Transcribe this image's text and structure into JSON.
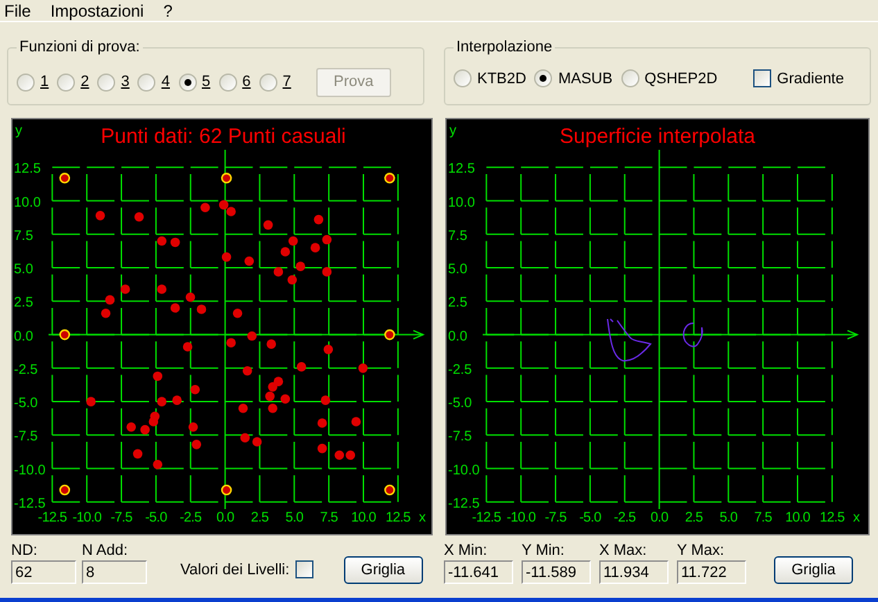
{
  "menu": [
    {
      "label": "File"
    },
    {
      "label": "Impostazioni"
    },
    {
      "label": "?"
    }
  ],
  "test_functions": {
    "title": "Funzioni di prova:",
    "options": [
      {
        "label": "1",
        "selected": false
      },
      {
        "label": "2",
        "selected": false
      },
      {
        "label": "3",
        "selected": false
      },
      {
        "label": "4",
        "selected": false
      },
      {
        "label": "5",
        "selected": true
      },
      {
        "label": "6",
        "selected": false
      },
      {
        "label": "7",
        "selected": false
      }
    ],
    "run_button": {
      "label": "Prova",
      "disabled": true
    }
  },
  "interpolation": {
    "title": "Interpolazione",
    "methods": [
      {
        "label": "KTB2D",
        "selected": false
      },
      {
        "label": "MASUB",
        "selected": true
      },
      {
        "label": "QSHEP2D",
        "selected": false
      }
    ],
    "gradient": {
      "label": "Gradiente",
      "checked": false
    }
  },
  "left_plot": {
    "chart_data": {
      "type": "scatter",
      "grid": true,
      "title": "Punti dati: 62 Punti casuali",
      "xlabel": "x",
      "ylabel": "y",
      "xlim": [
        -12.5,
        12.5
      ],
      "ylim": [
        -12.5,
        12.5
      ],
      "xticks": [
        {
          "value": -12.5,
          "label": "-12.5"
        },
        {
          "value": -10,
          "label": "-10.0"
        },
        {
          "value": -7.5,
          "label": "-7.5"
        },
        {
          "value": -5,
          "label": "-5.0"
        },
        {
          "value": -2.5,
          "label": "-2.5"
        },
        {
          "value": 0,
          "label": "0.0"
        },
        {
          "value": 2.5,
          "label": "2.5"
        },
        {
          "value": 5,
          "label": "5.0"
        },
        {
          "value": 7.5,
          "label": "7.5"
        },
        {
          "value": 10,
          "label": "10.0"
        },
        {
          "value": 12.5,
          "label": "12.5"
        }
      ],
      "yticks": [
        {
          "value": 12.5,
          "label": "12.5"
        },
        {
          "value": 10,
          "label": "10.0"
        },
        {
          "value": 7.5,
          "label": "7.5"
        },
        {
          "value": 5,
          "label": "5.0"
        },
        {
          "value": 2.5,
          "label": "2.5"
        },
        {
          "value": 0,
          "label": "0.0"
        },
        {
          "value": -2.5,
          "label": "-2.5"
        },
        {
          "value": -5,
          "label": "-5.0"
        },
        {
          "value": -7.5,
          "label": "-7.5"
        },
        {
          "value": -10,
          "label": "-10.0"
        },
        {
          "value": -12.5,
          "label": "-12.5"
        }
      ],
      "series": [
        {
          "color": "#e00000",
          "x": [
            -9.03,
            -6.22,
            -1.44,
            -0.1,
            0.43,
            3.11,
            6.76,
            -4.58,
            -3.61,
            4.92,
            7.36,
            6.52,
            4.35,
            0.1,
            1.74,
            5.45,
            3.85,
            4.85,
            7.36,
            -7.22,
            -4.58,
            -2.51,
            -8.33,
            -8.63,
            -3.61,
            -1.71,
            0.9,
            1.94,
            0.43,
            -2.71,
            3.34,
            7.46,
            5.52,
            1.61,
            9.97,
            -4.88,
            3.85,
            3.44,
            -2.17,
            3.24,
            4.35,
            -9.7,
            -4.58,
            -3.48,
            7.26,
            1.3,
            3.44,
            -5.08,
            -5.18,
            -6.79,
            -5.79,
            -2.31,
            7.02,
            9.47,
            1.44,
            2.31,
            -2.07,
            7.02,
            -6.32,
            8.26,
            9.06,
            -4.88
          ],
          "values": [
            8.9,
            8.8,
            9.5,
            9.7,
            9.2,
            8.2,
            8.6,
            7.0,
            6.9,
            7.0,
            7.1,
            6.5,
            6.2,
            5.8,
            5.5,
            5.1,
            4.7,
            4.1,
            4.7,
            3.4,
            3.4,
            2.8,
            2.6,
            1.6,
            2.0,
            1.9,
            1.6,
            -0.1,
            -0.6,
            -0.9,
            -0.7,
            -1.1,
            -2.4,
            -2.7,
            -2.5,
            -3.1,
            -3.5,
            -3.9,
            -4.1,
            -4.6,
            -4.8,
            -5.0,
            -5.0,
            -4.9,
            -4.9,
            -5.5,
            -5.5,
            -6.1,
            -6.5,
            -6.9,
            -7.1,
            -6.9,
            -6.6,
            -6.5,
            -7.7,
            -8.0,
            -8.2,
            -8.5,
            -8.9,
            -9.0,
            -9.0,
            -9.7
          ]
        },
        {
          "color": "#ffd700",
          "x": [
            -11.6,
            0.1,
            11.9,
            -11.6,
            11.9,
            -11.6,
            0.1,
            11.9
          ],
          "values": [
            11.7,
            11.7,
            11.7,
            0,
            0,
            -11.6,
            -11.6,
            -11.6
          ]
        }
      ]
    }
  },
  "right_plot": {
    "chart_data": {
      "type": "line",
      "grid": true,
      "title": "Superficie interpolata",
      "xlabel": "x",
      "ylabel": "y",
      "xlim": [
        -12.5,
        12.5
      ],
      "ylim": [
        -12.5,
        12.5
      ],
      "xticks": [
        {
          "value": -12.5,
          "label": "-12.5"
        },
        {
          "value": -10,
          "label": "-10.0"
        },
        {
          "value": -7.5,
          "label": "-7.5"
        },
        {
          "value": -5,
          "label": "-5.0"
        },
        {
          "value": -2.5,
          "label": "-2.5"
        },
        {
          "value": 0,
          "label": "0.0"
        },
        {
          "value": 2.5,
          "label": "2.5"
        },
        {
          "value": 5,
          "label": "5.0"
        },
        {
          "value": 7.5,
          "label": "7.5"
        },
        {
          "value": 10,
          "label": "10.0"
        },
        {
          "value": 12.5,
          "label": "12.5"
        }
      ],
      "yticks": [
        {
          "value": 12.5,
          "label": "12.5"
        },
        {
          "value": 10,
          "label": "10.0"
        },
        {
          "value": 7.5,
          "label": "7.5"
        },
        {
          "value": 5,
          "label": "5.0"
        },
        {
          "value": 2.5,
          "label": "2.5"
        },
        {
          "value": 0,
          "label": "0.0"
        },
        {
          "value": -2.5,
          "label": "-2.5"
        },
        {
          "value": -5,
          "label": "-5.0"
        },
        {
          "value": -7.5,
          "label": "-7.5"
        },
        {
          "value": -10,
          "label": "-10.0"
        },
        {
          "value": -12.5,
          "label": "-12.5"
        }
      ]
    }
  },
  "left_footer": {
    "nd": {
      "label": "ND:",
      "value": "62"
    },
    "n_add": {
      "label": "N Add:",
      "value": "8"
    },
    "level_values": {
      "label": "Valori dei Livelli:",
      "checked": false
    },
    "grid_button": "Griglia"
  },
  "right_footer": {
    "fields": [
      {
        "label": "X Min:",
        "value": "-11.641"
      },
      {
        "label": "Y Min:",
        "value": "-11.589"
      },
      {
        "label": "X Max:",
        "value": "11.934"
      },
      {
        "label": "Y Max:",
        "value": "11.722"
      }
    ],
    "grid_button": "Griglia"
  }
}
